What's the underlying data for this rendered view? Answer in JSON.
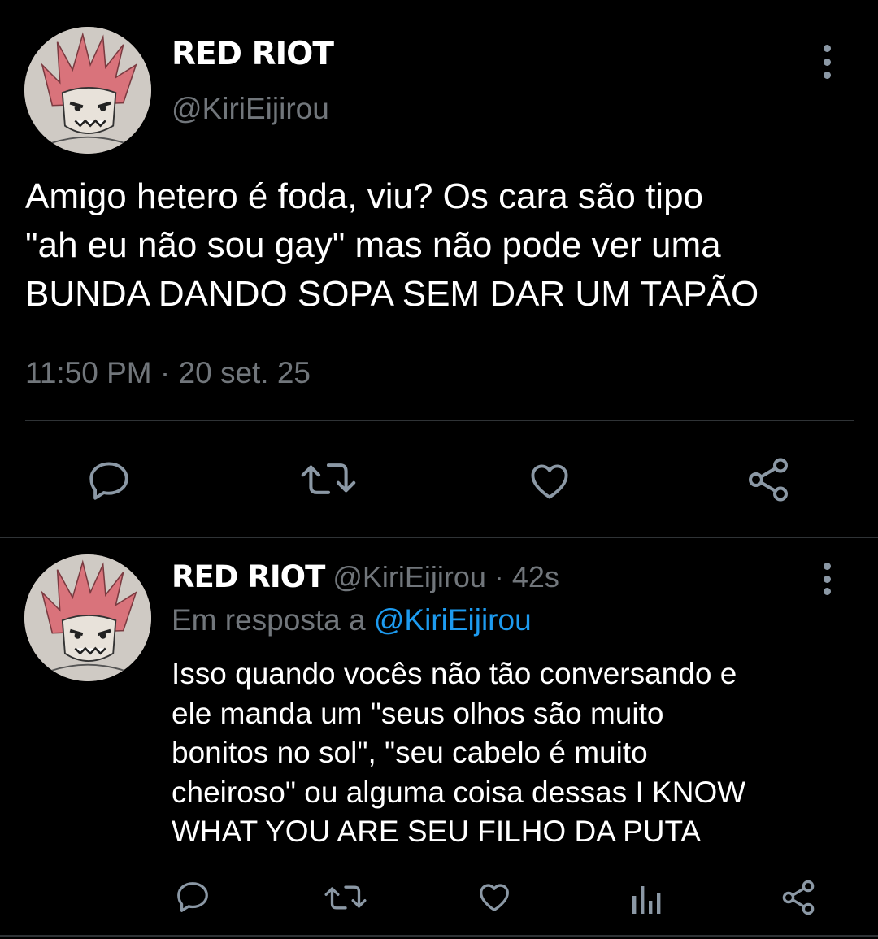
{
  "main_tweet": {
    "display_name": "RED RIOT",
    "handle": "@KiriEijirou",
    "text": "Amigo hetero é foda, viu? Os cara são tipo\n\"ah eu não sou gay\" mas não pode ver uma\nBUNDA DANDO SOPA SEM DAR UM TAPÃO",
    "timestamp": "11:50 PM · 20 set. 25"
  },
  "reply_tweet": {
    "display_name": "RED RIOT",
    "handle_time": " @KiriEijirou · 42s",
    "reply_prefix": "Em resposta a ",
    "reply_mention": "@KiriEijirou",
    "text": "Isso quando vocês não tão conversando e\nele manda um \"seus olhos são muito\nbonitos no sol\", \"seu cabelo é muito\ncheiroso\" ou alguma coisa dessas I KNOW\nWHAT YOU ARE SEU FILHO DA PUTA"
  },
  "icons": {
    "actions_main": [
      "reply-icon",
      "retweet-icon",
      "like-icon",
      "share-icon"
    ],
    "actions_reply": [
      "reply-icon",
      "retweet-icon",
      "like-icon",
      "analytics-icon",
      "share-icon"
    ],
    "menu": "more-vertical-icon"
  },
  "colors": {
    "background": "#000000",
    "text": "#ffffff",
    "secondary_text": "#71767b",
    "link": "#1d9bf0",
    "icon": "#8b98a5",
    "divider": "#2f3336"
  }
}
